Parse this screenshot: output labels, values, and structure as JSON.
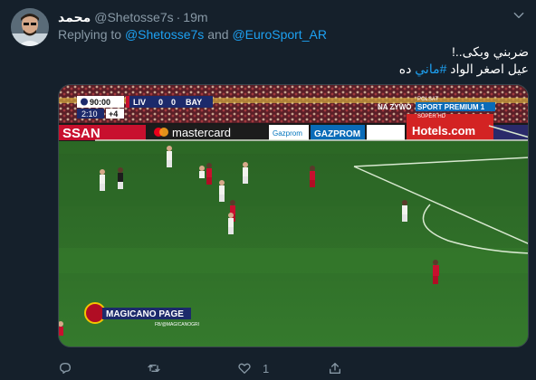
{
  "tweet": {
    "display_name": "محمد",
    "handle": "@Shetosse7s",
    "separator": "·",
    "timestamp": "19m",
    "reply_prefix": "Replying to",
    "reply_mention_1": "@Shetosse7s",
    "reply_and": "and",
    "reply_mention_2": "@EuroSport_AR",
    "line1": "ضربني وبكى..!",
    "line2_prefix": "عيل اصغر الواد ",
    "line2_hashtag": "#ماني",
    "line2_suffix": " ده"
  },
  "media": {
    "scoreboard": {
      "clock": "90:00",
      "home": "LIV",
      "home_score": "0",
      "away_score": "0",
      "away": "BAY",
      "added_time": "2:10",
      "added_plus": "+4"
    },
    "channel": {
      "broadcaster": "NA ZYWO",
      "name": "SPORT PREMIUM 1",
      "sub": "SUPER HD",
      "flag": "POLSAT"
    },
    "ads": {
      "left": "SSAN",
      "mastercard": "mastercard",
      "gazprom1": "Gazprom",
      "gazprom2": "GAZPROM",
      "hotels": "Hotels.com"
    },
    "watermark": {
      "name": "MAGICANO PAGE",
      "sub": "FB/@MAGICANOGRI"
    }
  },
  "actions": {
    "reply_count": "",
    "retweet_count": "",
    "like_count": "1",
    "share_count": ""
  },
  "colors": {
    "background": "#15202b",
    "secondary_text": "#8899a6",
    "accent": "#1da1f2",
    "pitch": "#2f6a29"
  }
}
